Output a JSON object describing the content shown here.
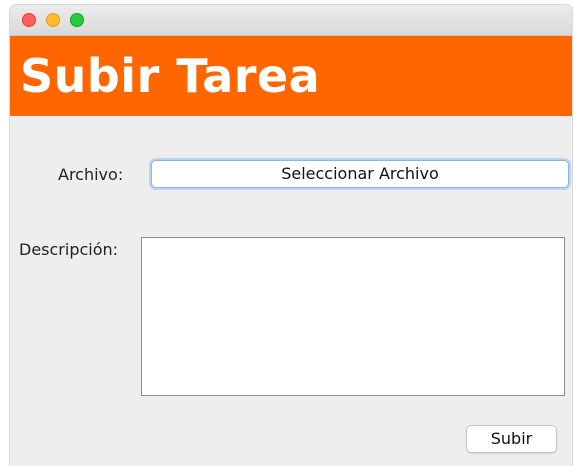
{
  "window": {
    "title_bar": {
      "controls": [
        "close",
        "minimize",
        "maximize"
      ],
      "colors": {
        "close": "#fe5f57",
        "minimize": "#febc2e",
        "maximize": "#28c840"
      }
    }
  },
  "header": {
    "title": "Subir Tarea",
    "background_color": "#ff6600",
    "text_color": "#ffffff"
  },
  "form": {
    "archivo_label": "Archivo:",
    "file_button_label": "Seleccionar Archivo",
    "descripcion_label": "Descripción:",
    "descripcion_value": "",
    "submit_label": "Subir"
  }
}
